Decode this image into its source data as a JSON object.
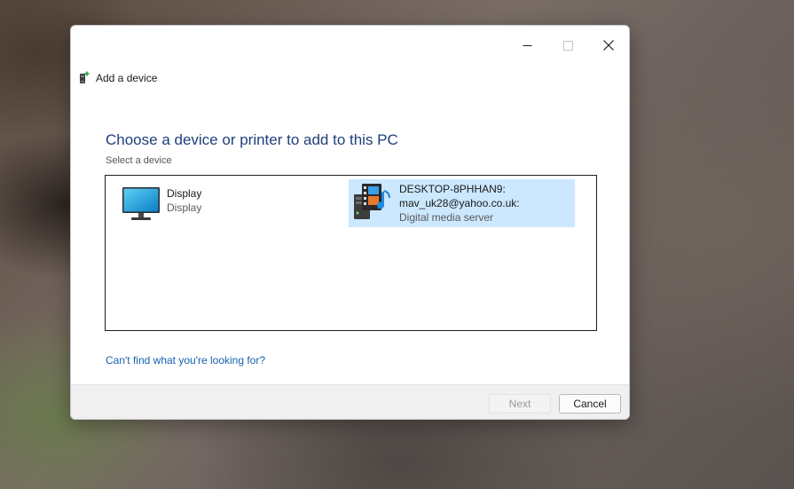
{
  "window": {
    "title": "Add a device",
    "controls": {
      "minimize_icon": "minimize-icon",
      "maximize_icon": "maximize-icon",
      "close_icon": "close-icon"
    }
  },
  "content": {
    "heading": "Choose a device or printer to add to this PC",
    "sub_label": "Select a device"
  },
  "devices": [
    {
      "name": "Display",
      "type": "Display",
      "icon": "monitor-icon",
      "selected": false
    },
    {
      "name_line1": "DESKTOP-8PHHAN9:",
      "name_line2": "mav_uk28@yahoo.co.uk:",
      "type": "Digital media server",
      "icon": "media-server-icon",
      "selected": true
    }
  ],
  "help_link": "Can't find what you're looking for?",
  "buttons": {
    "next": "Next",
    "cancel": "Cancel"
  },
  "colors": {
    "heading": "#1e3f7a",
    "link": "#1560b0",
    "selection": "#cce8ff",
    "footer": "#f0f0f0"
  }
}
